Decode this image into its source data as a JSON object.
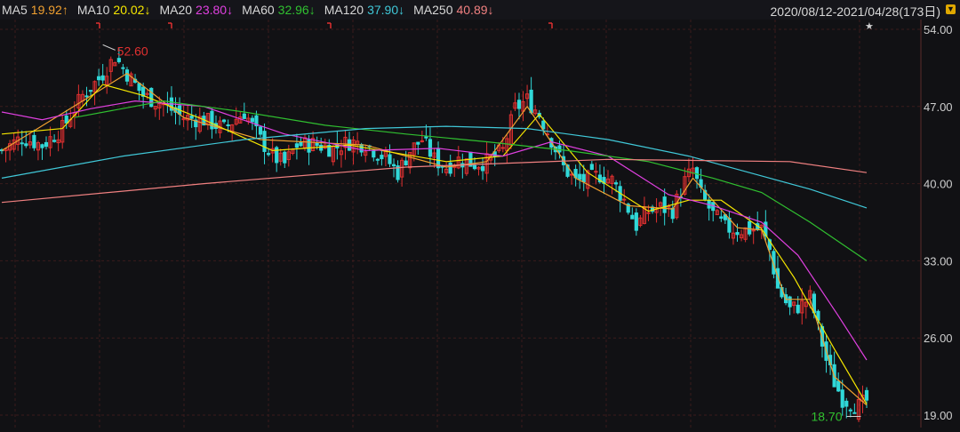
{
  "legend": {
    "items": [
      {
        "name": "MA5",
        "value": "19.92",
        "dir": "↑",
        "color": "#f0a030"
      },
      {
        "name": "MA10",
        "value": "20.02",
        "dir": "↓",
        "color": "#f5e600"
      },
      {
        "name": "MA20",
        "value": "23.80",
        "dir": "↓",
        "color": "#e040e0"
      },
      {
        "name": "MA60",
        "value": "32.96",
        "dir": "↓",
        "color": "#30c030"
      },
      {
        "name": "MA120",
        "value": "37.90",
        "dir": "↓",
        "color": "#40c8d8"
      },
      {
        "name": "MA250",
        "value": "40.89",
        "dir": "↓",
        "color": "#f08080"
      }
    ],
    "range": "2020/08/12-2021/04/28(173日)"
  },
  "colors": {
    "up": "#e03030",
    "down": "#30d8d8",
    "grid": "#3a1c1c",
    "bg": "#111114"
  },
  "chart_data": {
    "type": "candlestick",
    "y_ticks": [
      "54.00",
      "47.00",
      "40.00",
      "33.00",
      "26.00",
      "19.00"
    ],
    "ylim": [
      19,
      54
    ],
    "grid": true,
    "annotations": {
      "high": "52.60",
      "low": "18.70"
    },
    "close_points": [
      [
        0,
        43
      ],
      [
        5,
        44.2
      ],
      [
        10,
        43.5
      ],
      [
        15,
        45
      ],
      [
        20,
        48
      ],
      [
        24,
        49.5
      ],
      [
        28,
        51.5
      ],
      [
        31,
        50
      ],
      [
        35,
        48
      ],
      [
        40,
        47.2
      ],
      [
        45,
        46
      ],
      [
        50,
        45.8
      ],
      [
        55,
        45
      ],
      [
        60,
        46.5
      ],
      [
        64,
        44
      ],
      [
        67,
        42.5
      ],
      [
        70,
        41.8
      ],
      [
        73,
        43.5
      ],
      [
        77,
        43.6
      ],
      [
        82,
        43.2
      ],
      [
        86,
        43.8
      ],
      [
        90,
        43.6
      ],
      [
        95,
        42.3
      ],
      [
        98,
        41
      ],
      [
        101,
        43
      ],
      [
        104,
        44
      ],
      [
        107,
        42.2
      ],
      [
        110,
        41.5
      ],
      [
        113,
        42.2
      ],
      [
        117,
        41.8
      ],
      [
        120,
        42
      ],
      [
        124,
        43
      ],
      [
        127,
        46.8
      ],
      [
        130,
        47.6
      ],
      [
        133,
        46.3
      ],
      [
        136,
        44
      ],
      [
        139,
        41.5
      ],
      [
        142,
        40.2
      ],
      [
        145,
        40.4
      ],
      [
        148,
        40.8
      ],
      [
        151,
        40.3
      ],
      [
        154,
        38.5
      ],
      [
        157,
        36.2
      ],
      [
        160,
        37.5
      ],
      [
        163,
        37.8
      ],
      [
        166,
        37.6
      ],
      [
        169,
        40.2
      ],
      [
        171,
        41.3
      ],
      [
        173,
        39
      ],
      [
        176,
        37.2
      ],
      [
        179,
        36
      ],
      [
        182,
        35.8
      ],
      [
        185,
        35.8
      ],
      [
        188,
        35.9
      ],
      [
        190,
        34
      ],
      [
        192,
        30.5
      ],
      [
        195,
        28.6
      ],
      [
        198,
        29
      ],
      [
        200,
        29.7
      ],
      [
        202,
        27
      ],
      [
        204,
        24
      ],
      [
        206,
        22
      ],
      [
        208,
        20.5
      ],
      [
        210,
        20.1
      ],
      [
        212,
        19.8
      ],
      [
        214,
        20.3
      ]
    ],
    "ma_lines": [
      {
        "name": "MA5",
        "color": "#f0a030",
        "points": [
          [
            0,
            43
          ],
          [
            20,
            47.5
          ],
          [
            31,
            50
          ],
          [
            45,
            46
          ],
          [
            64,
            44
          ],
          [
            90,
            43.5
          ],
          [
            110,
            41.5
          ],
          [
            120,
            42
          ],
          [
            130,
            47
          ],
          [
            142,
            40.5
          ],
          [
            155,
            38
          ],
          [
            166,
            37.7
          ],
          [
            171,
            40.5
          ],
          [
            182,
            36
          ],
          [
            188,
            35.8
          ],
          [
            194,
            29.5
          ],
          [
            200,
            29.5
          ],
          [
            206,
            22.5
          ],
          [
            214,
            19.9
          ]
        ]
      },
      {
        "name": "MA10",
        "color": "#f5e600",
        "points": [
          [
            0,
            44.5
          ],
          [
            15,
            45
          ],
          [
            25,
            49
          ],
          [
            35,
            48
          ],
          [
            50,
            45.8
          ],
          [
            67,
            43
          ],
          [
            86,
            43.5
          ],
          [
            110,
            42
          ],
          [
            124,
            42.5
          ],
          [
            133,
            46.3
          ],
          [
            145,
            41
          ],
          [
            160,
            37.5
          ],
          [
            170,
            38.5
          ],
          [
            178,
            38.5
          ],
          [
            188,
            35.9
          ],
          [
            196,
            31.5
          ],
          [
            206,
            25
          ],
          [
            214,
            20
          ]
        ]
      },
      {
        "name": "MA20",
        "color": "#e040e0",
        "points": [
          [
            0,
            46.5
          ],
          [
            10,
            45.8
          ],
          [
            22,
            46.8
          ],
          [
            33,
            47.5
          ],
          [
            50,
            47
          ],
          [
            70,
            44.5
          ],
          [
            90,
            43
          ],
          [
            108,
            43.2
          ],
          [
            124,
            42.5
          ],
          [
            136,
            43.8
          ],
          [
            150,
            42.5
          ],
          [
            165,
            39
          ],
          [
            176,
            38
          ],
          [
            188,
            36.5
          ],
          [
            197,
            33.5
          ],
          [
            207,
            28
          ],
          [
            214,
            24
          ]
        ]
      },
      {
        "name": "MA60",
        "color": "#30c030",
        "points": [
          [
            18,
            46
          ],
          [
            40,
            47.5
          ],
          [
            60,
            46.5
          ],
          [
            80,
            45.3
          ],
          [
            100,
            44.5
          ],
          [
            120,
            43.8
          ],
          [
            140,
            43
          ],
          [
            160,
            42
          ],
          [
            176,
            40.5
          ],
          [
            188,
            39.2
          ],
          [
            200,
            36.5
          ],
          [
            214,
            33
          ]
        ]
      },
      {
        "name": "MA120",
        "color": "#40c8d8",
        "points": [
          [
            0,
            40.5
          ],
          [
            30,
            42.5
          ],
          [
            60,
            44
          ],
          [
            90,
            45
          ],
          [
            110,
            45.2
          ],
          [
            130,
            45
          ],
          [
            150,
            44
          ],
          [
            170,
            42.5
          ],
          [
            185,
            41
          ],
          [
            200,
            39.5
          ],
          [
            214,
            37.8
          ]
        ]
      },
      {
        "name": "MA250",
        "color": "#f08080",
        "points": [
          [
            0,
            38.3
          ],
          [
            50,
            40
          ],
          [
            100,
            41.5
          ],
          [
            150,
            42.2
          ],
          [
            195,
            42
          ],
          [
            214,
            41
          ]
        ]
      }
    ]
  }
}
